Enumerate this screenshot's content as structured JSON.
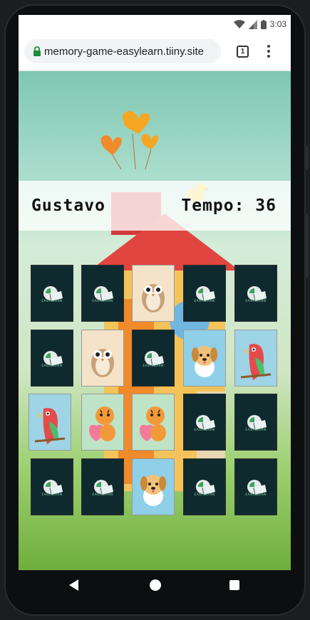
{
  "status_bar": {
    "time": "3:03"
  },
  "browser": {
    "url": "memory-game-easylearn.tiiny.site",
    "tab_count": "1"
  },
  "game": {
    "player_name": "Gustavo",
    "timer_label": "Tempo:",
    "timer_value": "36",
    "card_back_brand": "EASYLEARN",
    "cards": [
      {
        "state": "back"
      },
      {
        "state": "back"
      },
      {
        "state": "face",
        "animal": "owl"
      },
      {
        "state": "back"
      },
      {
        "state": "back"
      },
      {
        "state": "back"
      },
      {
        "state": "face",
        "animal": "owl"
      },
      {
        "state": "back"
      },
      {
        "state": "face",
        "animal": "dog"
      },
      {
        "state": "face",
        "animal": "parrot"
      },
      {
        "state": "face",
        "animal": "parrot"
      },
      {
        "state": "face",
        "animal": "tiger"
      },
      {
        "state": "face",
        "animal": "tiger"
      },
      {
        "state": "back"
      },
      {
        "state": "back"
      },
      {
        "state": "back"
      },
      {
        "state": "back"
      },
      {
        "state": "face",
        "animal": "dog"
      },
      {
        "state": "back"
      },
      {
        "state": "back"
      }
    ]
  },
  "icons": {
    "status": [
      "wifi-icon",
      "signal-icon",
      "battery-icon"
    ],
    "browser": [
      "lock-icon",
      "tabs-icon",
      "menu-icon"
    ],
    "nav": [
      "back-icon",
      "home-icon",
      "recents-icon"
    ]
  },
  "colors": {
    "card_back": "#0f2a2e",
    "secure_lock": "#1e8e3e"
  }
}
